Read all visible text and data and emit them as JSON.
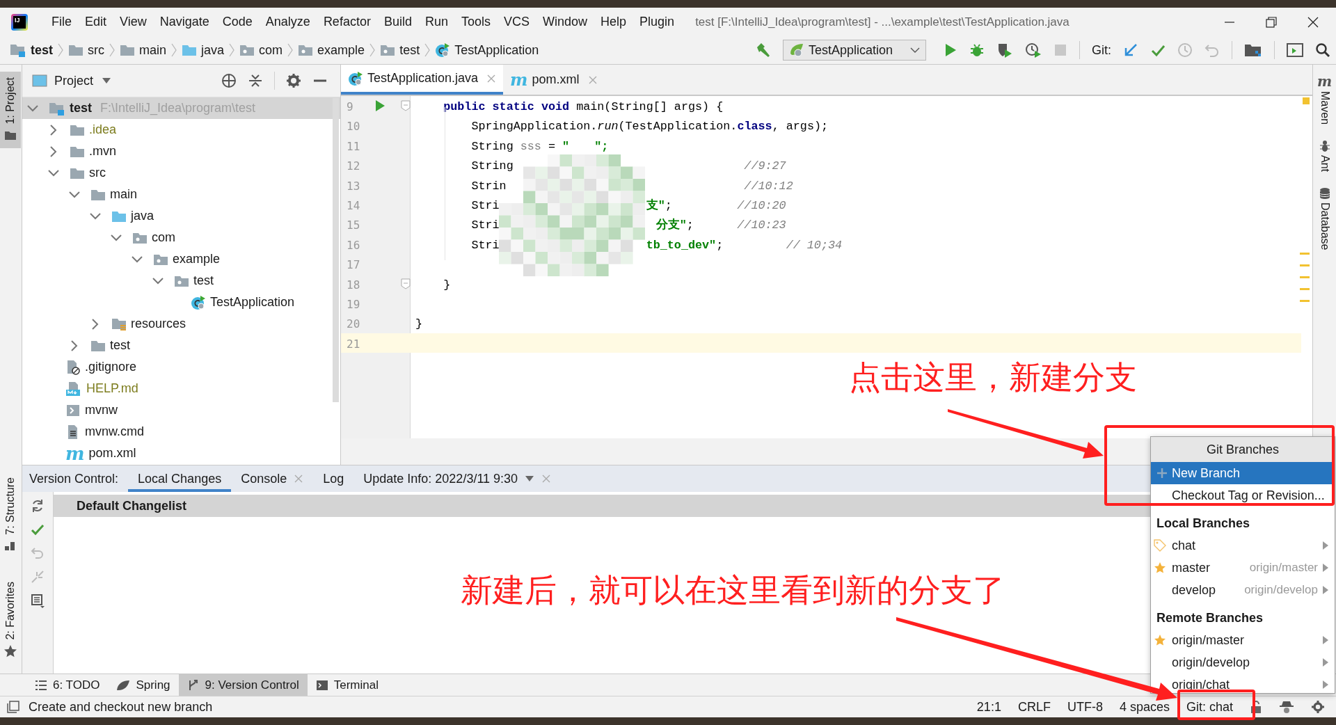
{
  "app": {
    "logo_text": "IJ"
  },
  "menu": [
    "File",
    "Edit",
    "View",
    "Navigate",
    "Code",
    "Analyze",
    "Refactor",
    "Build",
    "Run",
    "Tools",
    "VCS",
    "Window",
    "Help",
    "Plugin"
  ],
  "window": {
    "title": "test [F:\\IntelliJ_Idea\\program\\test] - ...\\example\\test\\TestApplication.java"
  },
  "breadcrumbs": [
    {
      "label": "test",
      "kind": "module"
    },
    {
      "label": "src",
      "kind": "folder"
    },
    {
      "label": "main",
      "kind": "folder"
    },
    {
      "label": "java",
      "kind": "source-folder"
    },
    {
      "label": "com",
      "kind": "package"
    },
    {
      "label": "example",
      "kind": "package"
    },
    {
      "label": "test",
      "kind": "package"
    },
    {
      "label": "TestApplication",
      "kind": "class"
    }
  ],
  "toolbar": {
    "run_config": "TestApplication",
    "git_label": "Git:"
  },
  "left_tool_tabs": [
    {
      "label": "1: Project",
      "selected": true
    },
    {
      "label": "7: Structure",
      "selected": false
    },
    {
      "label": "2: Favorites",
      "selected": false
    }
  ],
  "right_tool_tabs": [
    {
      "label": "Maven",
      "kind": "maven",
      "icon_glyph": "m"
    },
    {
      "label": "Ant",
      "kind": "ant"
    },
    {
      "label": "Database",
      "kind": "database"
    }
  ],
  "project_panel": {
    "title": "Project",
    "tree": [
      {
        "label": "test",
        "path": "F:\\IntelliJ_Idea\\program\\test",
        "kind": "module",
        "expanded": true,
        "selected": true,
        "vcs_ignored": false,
        "children": [
          {
            "label": ".idea",
            "kind": "folder",
            "expanded": false,
            "selected": false,
            "vcs_ignored": true
          },
          {
            "label": ".mvn",
            "kind": "folder",
            "expanded": false,
            "selected": false,
            "vcs_ignored": false
          },
          {
            "label": "src",
            "kind": "folder",
            "expanded": true,
            "selected": false,
            "vcs_ignored": false,
            "children": [
              {
                "label": "main",
                "kind": "folder",
                "expanded": true,
                "selected": false,
                "vcs_ignored": false,
                "children": [
                  {
                    "label": "java",
                    "kind": "source-folder",
                    "expanded": true,
                    "selected": false,
                    "vcs_ignored": false,
                    "children": [
                      {
                        "label": "com",
                        "kind": "package",
                        "expanded": true,
                        "selected": false,
                        "vcs_ignored": false,
                        "children": [
                          {
                            "label": "example",
                            "kind": "package",
                            "expanded": true,
                            "selected": false,
                            "vcs_ignored": false,
                            "children": [
                              {
                                "label": "test",
                                "kind": "package",
                                "expanded": true,
                                "selected": false,
                                "vcs_ignored": false,
                                "children": [
                                  {
                                    "label": "TestApplication",
                                    "kind": "class",
                                    "selected": false,
                                    "vcs_ignored": false
                                  }
                                ]
                              }
                            ]
                          }
                        ]
                      }
                    ]
                  },
                  {
                    "label": "resources",
                    "kind": "resources-folder",
                    "expanded": false,
                    "selected": false,
                    "vcs_ignored": false
                  }
                ]
              },
              {
                "label": "test",
                "kind": "folder",
                "expanded": false,
                "selected": false,
                "vcs_ignored": false
              }
            ]
          },
          {
            "label": ".gitignore",
            "kind": "ignore-file",
            "selected": false,
            "vcs_ignored": false
          },
          {
            "label": "HELP.md",
            "kind": "markdown",
            "selected": false,
            "vcs_ignored": true
          },
          {
            "label": "mvnw",
            "kind": "script",
            "selected": false,
            "vcs_ignored": false
          },
          {
            "label": "mvnw.cmd",
            "kind": "text-file",
            "selected": false,
            "vcs_ignored": false
          },
          {
            "label": "pom.xml",
            "kind": "maven",
            "icon_glyph": "m",
            "selected": false,
            "vcs_ignored": false
          }
        ]
      }
    ]
  },
  "editor": {
    "tabs": [
      {
        "label": "TestApplication.java",
        "kind": "class",
        "selected": true
      },
      {
        "label": "pom.xml",
        "kind": "maven",
        "icon_glyph": "m",
        "selected": false
      }
    ],
    "lines": [
      {
        "number": "9",
        "run_marker": true,
        "fold_marker": true,
        "current": false,
        "segments": [
          {
            "text": "public static void",
            "kind": "keyword"
          },
          {
            "text": "main(String[] args) {",
            "kind": "plain"
          }
        ]
      },
      {
        "number": "10",
        "run_marker": false,
        "fold_marker": false,
        "current": false,
        "segments": [
          {
            "text": "SpringApplication.",
            "kind": "plain"
          },
          {
            "text": "run",
            "kind": "method"
          },
          {
            "text": "(TestApplication.",
            "kind": "plain"
          },
          {
            "text": "class",
            "kind": "keyword"
          },
          {
            "text": ", args);",
            "kind": "plain"
          }
        ]
      },
      {
        "number": "11",
        "run_marker": false,
        "fold_marker": false,
        "current": false,
        "segments": [
          {
            "text": "String",
            "kind": "plain"
          },
          {
            "text": "sss",
            "kind": "unused"
          },
          {
            "text": "=",
            "kind": "plain"
          },
          {
            "text": "\"",
            "kind": "string"
          },
          {
            "text": "\";",
            "kind": "string"
          }
        ]
      },
      {
        "number": "12",
        "run_marker": false,
        "fold_marker": false,
        "current": false,
        "segments": [
          {
            "text": "String",
            "kind": "plain"
          },
          {
            "text": "//9:27",
            "kind": "comment"
          }
        ]
      },
      {
        "number": "13",
        "run_marker": false,
        "fold_marker": false,
        "current": false,
        "segments": [
          {
            "text": "Strin",
            "kind": "plain"
          },
          {
            "text": "//10:12",
            "kind": "comment"
          }
        ]
      },
      {
        "number": "14",
        "run_marker": false,
        "fold_marker": false,
        "current": false,
        "segments": [
          {
            "text": "Stri",
            "kind": "plain"
          },
          {
            "text": "支\"",
            "kind": "string"
          },
          {
            "text": ";",
            "kind": "plain"
          },
          {
            "text": "//10:20",
            "kind": "comment"
          }
        ]
      },
      {
        "number": "15",
        "run_marker": false,
        "fold_marker": false,
        "current": false,
        "segments": [
          {
            "text": "Stri",
            "kind": "plain"
          },
          {
            "text": "分支\"",
            "kind": "string"
          },
          {
            "text": ";",
            "kind": "plain"
          },
          {
            "text": "//10:23",
            "kind": "comment"
          }
        ]
      },
      {
        "number": "16",
        "run_marker": false,
        "fold_marker": false,
        "current": false,
        "segments": [
          {
            "text": "Stri",
            "kind": "plain"
          },
          {
            "text": "tb_to_dev\"",
            "kind": "string"
          },
          {
            "text": ";",
            "kind": "plain"
          },
          {
            "text": "// 10;34",
            "kind": "comment"
          }
        ]
      },
      {
        "number": "17",
        "run_marker": false,
        "fold_marker": false,
        "current": false
      },
      {
        "number": "18",
        "run_marker": false,
        "fold_marker": true,
        "current": false,
        "segments": [
          {
            "text": "}",
            "kind": "plain"
          }
        ]
      },
      {
        "number": "19",
        "run_marker": false,
        "fold_marker": false,
        "current": false
      },
      {
        "number": "20",
        "run_marker": false,
        "fold_marker": false,
        "current": false,
        "segments": [
          {
            "text": "}",
            "kind": "plain"
          }
        ]
      },
      {
        "number": "21",
        "run_marker": false,
        "fold_marker": false,
        "current": true
      }
    ]
  },
  "bottom_panel": {
    "title": "Version Control:",
    "tabs": [
      {
        "label": "Local Changes",
        "closable": false,
        "dropdown": false,
        "selected": true
      },
      {
        "label": "Console",
        "closable": true,
        "dropdown": false,
        "selected": false
      },
      {
        "label": "Log",
        "closable": false,
        "dropdown": false,
        "selected": false
      },
      {
        "label": "Update Info: 2022/3/11 9:30",
        "closable": true,
        "dropdown": true,
        "selected": false
      }
    ],
    "changelist": "Default Changelist"
  },
  "tool_buttons": [
    {
      "label": "6: TODO",
      "kind": "todo",
      "selected": false
    },
    {
      "label": "Spring",
      "kind": "spring",
      "selected": false
    },
    {
      "label": "9: Version Control",
      "kind": "vcs",
      "selected": true
    },
    {
      "label": "Terminal",
      "kind": "terminal",
      "selected": false
    }
  ],
  "status_bar": {
    "message": "Create and checkout new branch",
    "items": [
      "21:1",
      "CRLF",
      "UTF-8",
      "4 spaces",
      "Git: chat"
    ]
  },
  "git_branches_popup": {
    "title": "Git Branches",
    "actions": [
      {
        "label": "New Branch",
        "kind": "new",
        "selected": true
      },
      {
        "label": "Checkout Tag or Revision...",
        "kind": "checkout",
        "selected": false
      }
    ],
    "sections": [
      {
        "title": "Local Branches",
        "branches": [
          {
            "name": "chat",
            "kind": "tag"
          },
          {
            "name": "master",
            "tracking": "origin/master",
            "kind": "star"
          },
          {
            "name": "develop",
            "tracking": "origin/develop",
            "kind": "none"
          }
        ]
      },
      {
        "title": "Remote Branches",
        "branches": [
          {
            "name": "origin/master",
            "kind": "star"
          },
          {
            "name": "origin/develop",
            "kind": "none"
          },
          {
            "name": "origin/chat",
            "kind": "none"
          }
        ]
      }
    ]
  },
  "annotations": [
    "点击这里，新建分支",
    "新建后，就可以在这里看到新的分支了"
  ]
}
